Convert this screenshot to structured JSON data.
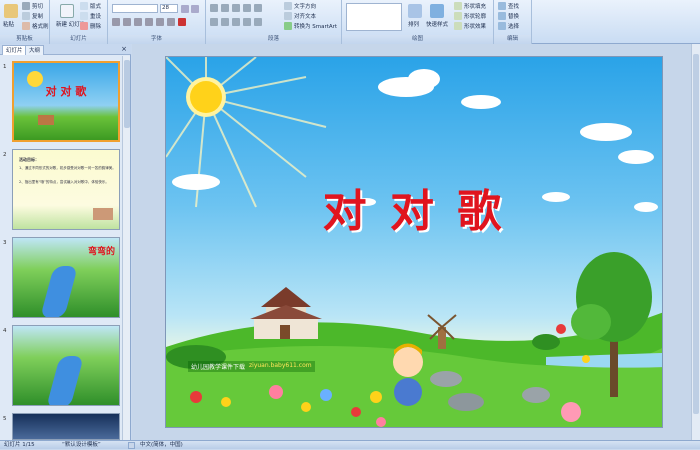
{
  "ribbon": {
    "clipboard": {
      "label": "剪贴板",
      "paste": "粘贴",
      "cut": "剪切",
      "copy": "复制",
      "format": "格式刷"
    },
    "slides": {
      "label": "幻灯片",
      "new_slide": "新建\n幻灯片",
      "layout": "版式",
      "reset": "重设",
      "delete": "删除"
    },
    "font": {
      "label": "字体",
      "size": "28"
    },
    "paragraph": {
      "label": "段落",
      "text_dir": "文字方向",
      "align_text": "对齐文本",
      "smartart": "转换为 SmartArt"
    },
    "drawing": {
      "label": "绘图",
      "arrange": "排列",
      "quick_styles": "快速样式",
      "fill": "形状填充",
      "outline": "形状轮廓",
      "effects": "形状效果"
    },
    "editing": {
      "label": "编辑",
      "find": "查找",
      "replace": "替换",
      "select": "选择"
    }
  },
  "panel": {
    "tab_slides": "幻灯片",
    "tab_outline": "大纲",
    "thumbs": [
      {
        "num": "1",
        "title": "对 对 歌"
      },
      {
        "num": "2",
        "lines": [
          "活动目标：",
          "1、通过不同形式的对歌，初步感受对对歌一问一答的韵律美。",
          "2、指出里有“哦”的特点，尝试编入对对歌中，体验快乐。"
        ]
      },
      {
        "num": "3",
        "title": "弯弯的"
      },
      {
        "num": "4"
      },
      {
        "num": "5"
      }
    ]
  },
  "slide": {
    "title": "对 对 歌",
    "watermark": "幼儿园教学课件下载",
    "url": "ziyuan.baby611.com"
  },
  "status": {
    "slide_count": "幻灯片 1/15",
    "theme": "“默认设计模板”",
    "lang": "中文(简体，中国)"
  },
  "colors": {
    "title_red": "#e0141e",
    "ribbon_bg": "#dce8f7",
    "sky": "#2aa3e8",
    "grass": "#4cb82a"
  }
}
